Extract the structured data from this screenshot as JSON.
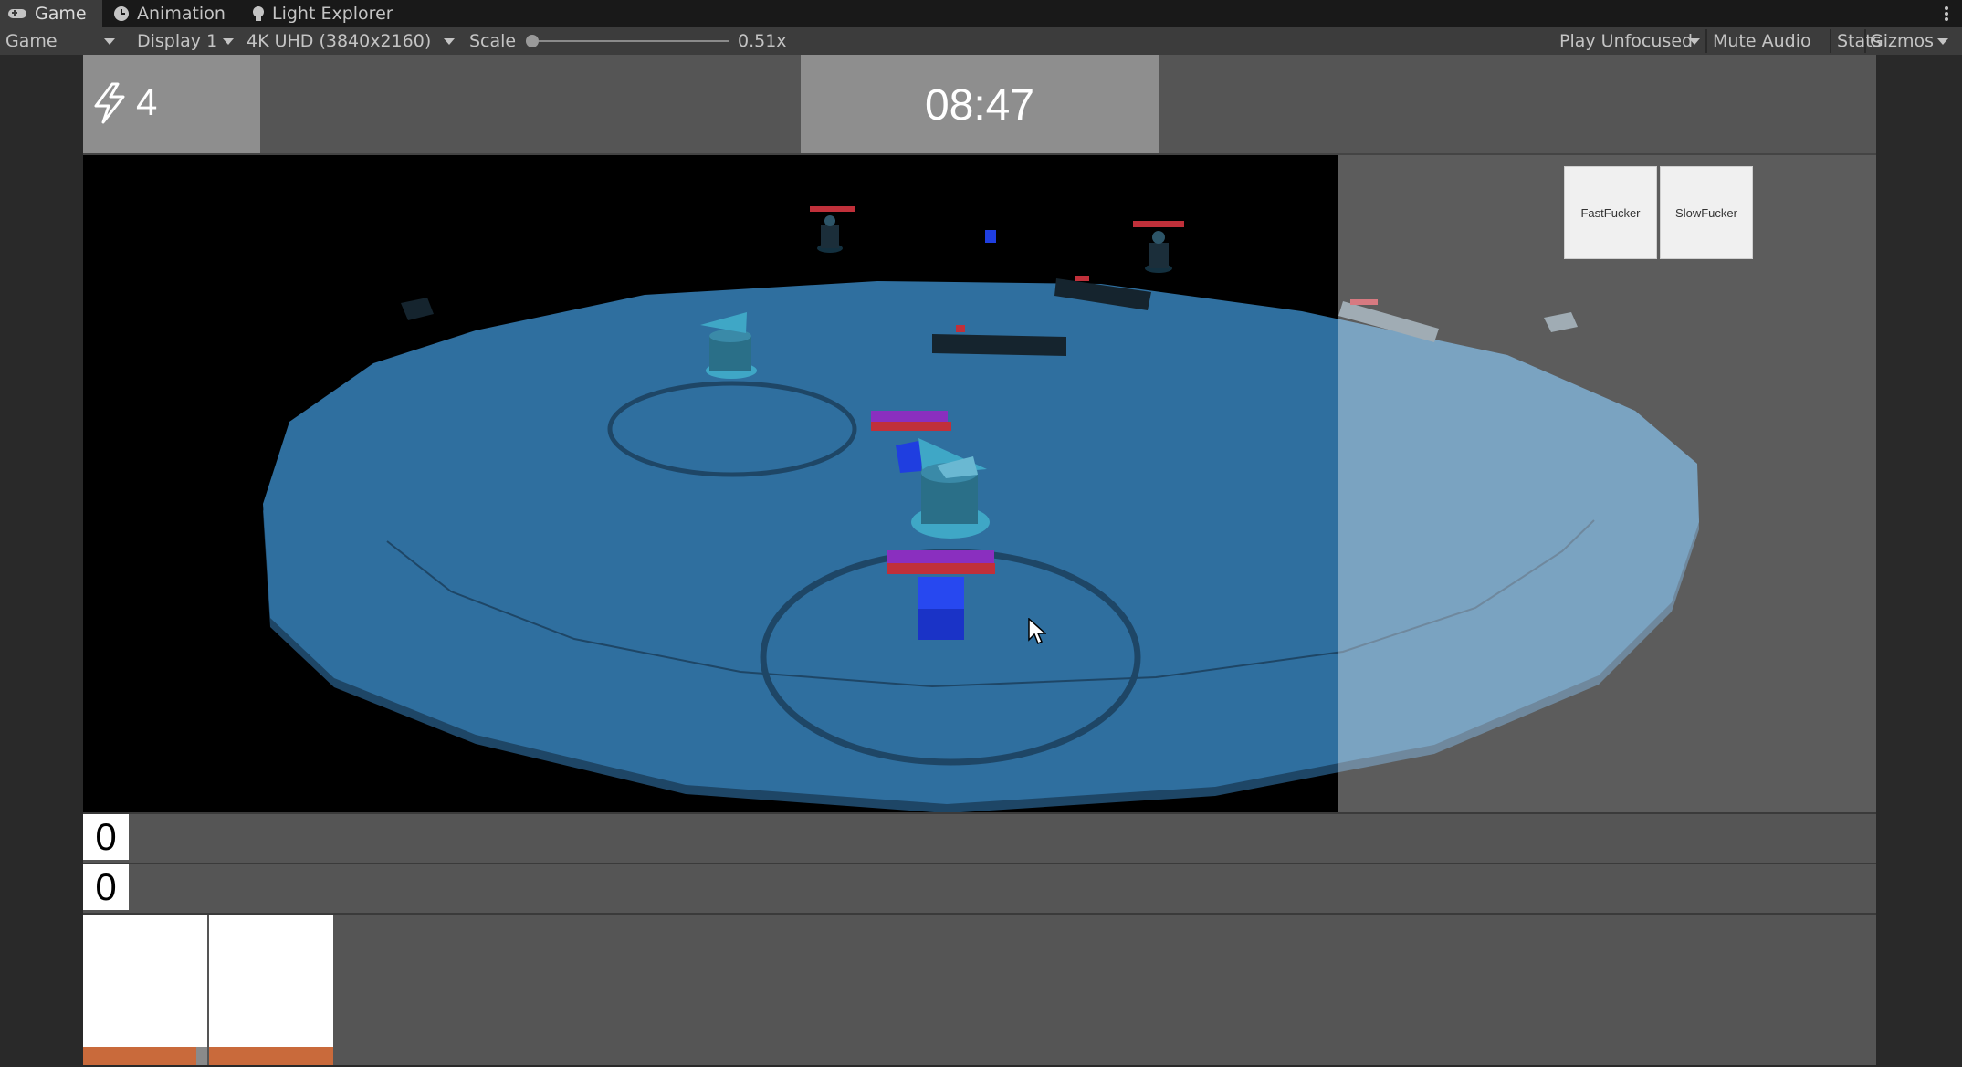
{
  "tabs": [
    {
      "label": "Game",
      "icon": "gamepad-icon",
      "active": true
    },
    {
      "label": "Animation",
      "icon": "clock-icon",
      "active": false
    },
    {
      "label": "Light Explorer",
      "icon": "lightbulb-icon",
      "active": false
    }
  ],
  "toolbar": {
    "view_mode": "Game",
    "display": "Display 1",
    "resolution": "4K UHD (3840x2160)",
    "scale_label": "Scale",
    "scale_value": "0.51x",
    "scale_level": 0.0,
    "play_unfocused": "Play Unfocused",
    "mute_audio": "Mute Audio",
    "stats": "Stats",
    "gizmos": "Gizmos"
  },
  "hud": {
    "energy_icon": "lightning-icon",
    "energy": "4",
    "timer": "08:47",
    "buttons": [
      "FastFucker",
      "SlowFucker"
    ],
    "scores": [
      "0",
      "0"
    ],
    "cards": [
      {
        "fill_color": "#c96a3b"
      },
      {
        "fill_color": "#c96a3b"
      }
    ]
  },
  "colors": {
    "arena": "#2f6f9f",
    "arena_edge": "#1b3f5c",
    "tower": "#3fa7c6",
    "health_red": "#c0303a",
    "shield_purple": "#8a2fbf",
    "unit_blue": "#1f3ee0",
    "editor_bg": "#191919",
    "toolbar_bg": "#3c3c3c"
  }
}
